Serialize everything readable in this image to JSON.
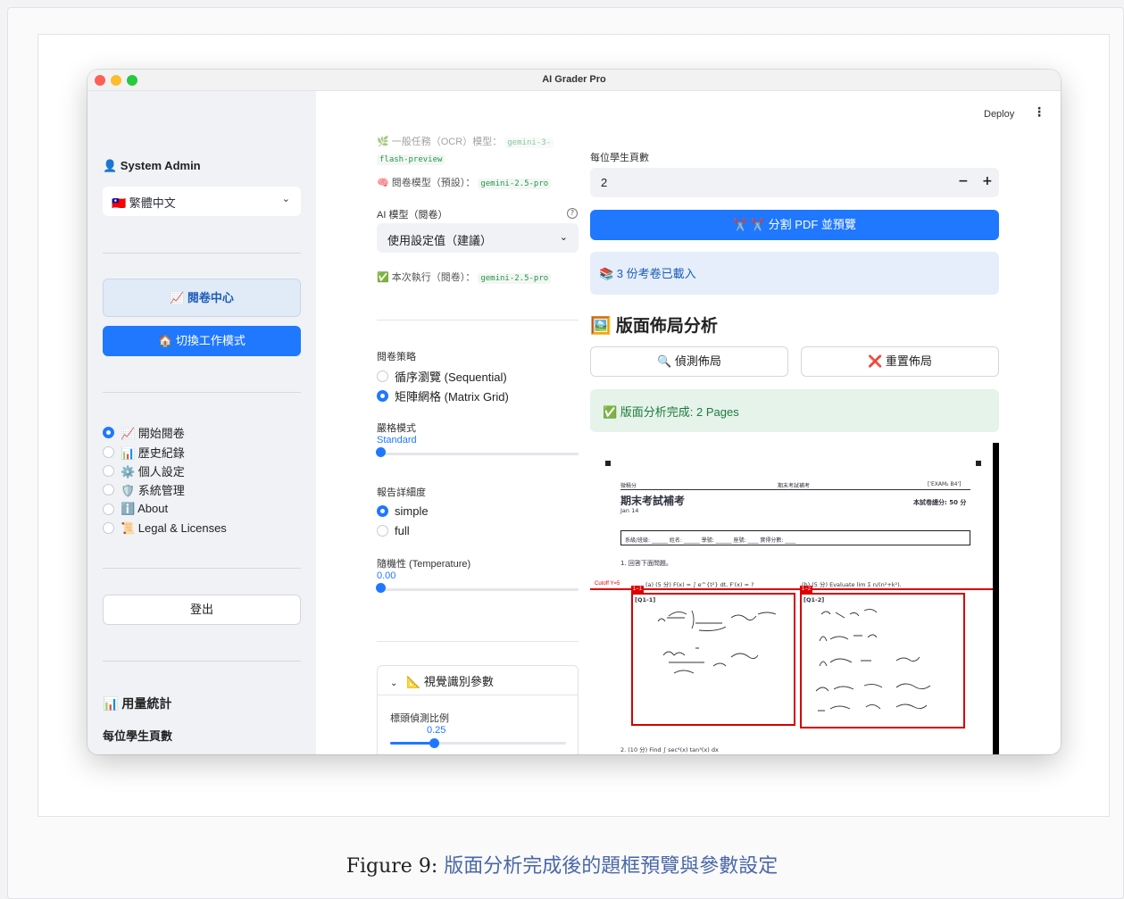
{
  "window": {
    "title": "AI Grader Pro"
  },
  "sidebar": {
    "user": "👤 System Admin",
    "language": "🇹🇼 繁體中文",
    "grading_center": "📈 閱卷中心",
    "switch_mode": "🏠 切換工作模式",
    "nav": [
      {
        "label": "📈 開始閱卷",
        "selected": true
      },
      {
        "label": "📊 歷史紀錄",
        "selected": false
      },
      {
        "label": "⚙️ 個人設定",
        "selected": false
      },
      {
        "label": "🛡️ 系統管理",
        "selected": false
      },
      {
        "label": "ℹ️ About",
        "selected": false
      },
      {
        "label": "📜 Legal & Licenses",
        "selected": false
      }
    ],
    "logout": "登出",
    "usage_title": "📊 用量統計",
    "usage_sub": "每位學生頁數"
  },
  "header": {
    "deploy": "Deploy",
    "menu_icon": "⋮"
  },
  "left_col": {
    "ocr_model_line1": "🌿 一般任務（OCR）模型：",
    "ocr_model_tag_a": "gemini-3-",
    "ocr_model_tag_b": "flash-preview",
    "grading_model_label": "🧠 閱卷模型（預設）：",
    "grading_model_tag": "gemini-2.5-pro",
    "ai_model_label": "AI 模型（閱卷）",
    "ai_model_value": "使用設定值（建議）",
    "run_label": "✅ 本次執行（閱卷）：",
    "run_tag": "gemini-2.5-pro",
    "strategy_label": "閱卷策略",
    "strategy_options": [
      {
        "label": "循序瀏覽 (Sequential)",
        "selected": false
      },
      {
        "label": "矩陣網格 (Matrix Grid)",
        "selected": true
      }
    ],
    "strict_label": "嚴格模式",
    "strict_value": "Standard",
    "detail_label": "報告詳細度",
    "detail_options": [
      {
        "label": "simple",
        "selected": true
      },
      {
        "label": "full",
        "selected": false
      }
    ],
    "temp_label": "隨機性 (Temperature)",
    "temp_value": "0.00",
    "expander_title": "📐 視覺識別參數",
    "header_ratio_label": "標頭偵測比例",
    "header_ratio_value": "0.25",
    "header_ratio_fraction": 0.25
  },
  "right_col": {
    "pages_label": "每位學生頁數",
    "pages_value": "2",
    "minus": "−",
    "plus": "+",
    "split_button": "✂️ ✂️ 分割 PDF 並預覽",
    "loaded_info": "📚 3 份考卷已載入",
    "layout_title": "🖼️ 版面佈局分析",
    "detect_button": "🔍 偵測佈局",
    "reset_button": "❌ 重置佈局",
    "success_msg": "✅ 版面分析完成: 2 Pages"
  },
  "preview": {
    "header_left": "微積分",
    "header_mid": "期末考試補考",
    "header_right": "['EXAM₂ B4']",
    "title": "期末考試補考",
    "date": "Jan 14",
    "score_note": "本試卷總分: 50 分",
    "info_row": "系級/班級: ______  姓名: ______  學號: ______  座號: ____  實得分數: ____",
    "q_intro": "1. 回答下面問題。",
    "cutoff": "Cutoff Y=5",
    "q1a": "(a) (5 分) F(x) = ∫ e^{t²} dt. F′(x) = ?",
    "q1b": "(b) (5 分) Evaluate lim Σ n/(n²+k²).",
    "box1_tag": "1−1",
    "box1_label": "[Q1-1]",
    "box2_tag": "1−2",
    "box2_label": "[Q1-2]",
    "q2": "2. (10 分) Find ∫ sec⁴(x) tan³(x) dx"
  },
  "caption": {
    "number": "Figure 9:",
    "text": "版面分析完成後的題框預覽與參數設定"
  },
  "colors": {
    "primary": "#1f78ff",
    "success": "#1c7b3c",
    "box_red": "#d40000"
  }
}
